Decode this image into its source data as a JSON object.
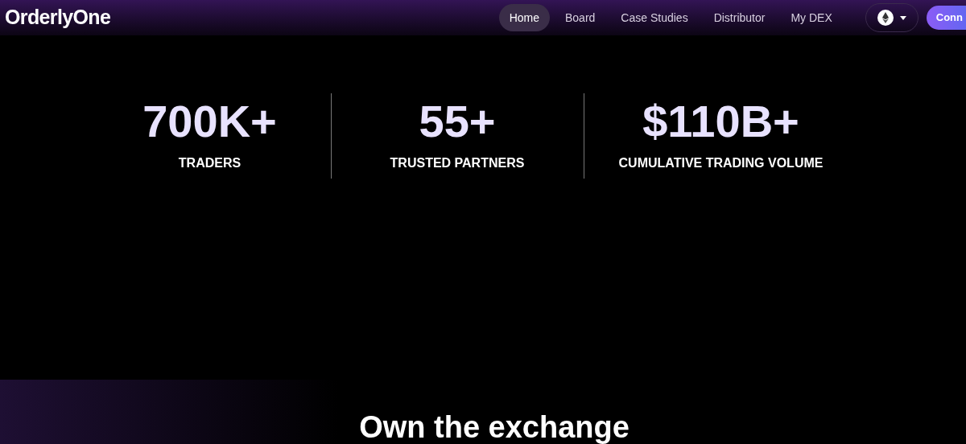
{
  "header": {
    "logo": "OrderlyOne",
    "nav": [
      {
        "label": "Home",
        "selected": true
      },
      {
        "label": "Board",
        "selected": false
      },
      {
        "label": "Case Studies",
        "selected": false
      },
      {
        "label": "Distributor",
        "selected": false
      },
      {
        "label": "My DEX",
        "selected": false
      }
    ],
    "connect_button": "Conn"
  },
  "stats": [
    {
      "value": "700K+",
      "label": "TRADERS"
    },
    {
      "value": "55+",
      "label": "TRUSTED PARTNERS"
    },
    {
      "value": "$110B+",
      "label": "CUMULATIVE TRADING VOLUME"
    }
  ],
  "heading": "Own the exchange"
}
